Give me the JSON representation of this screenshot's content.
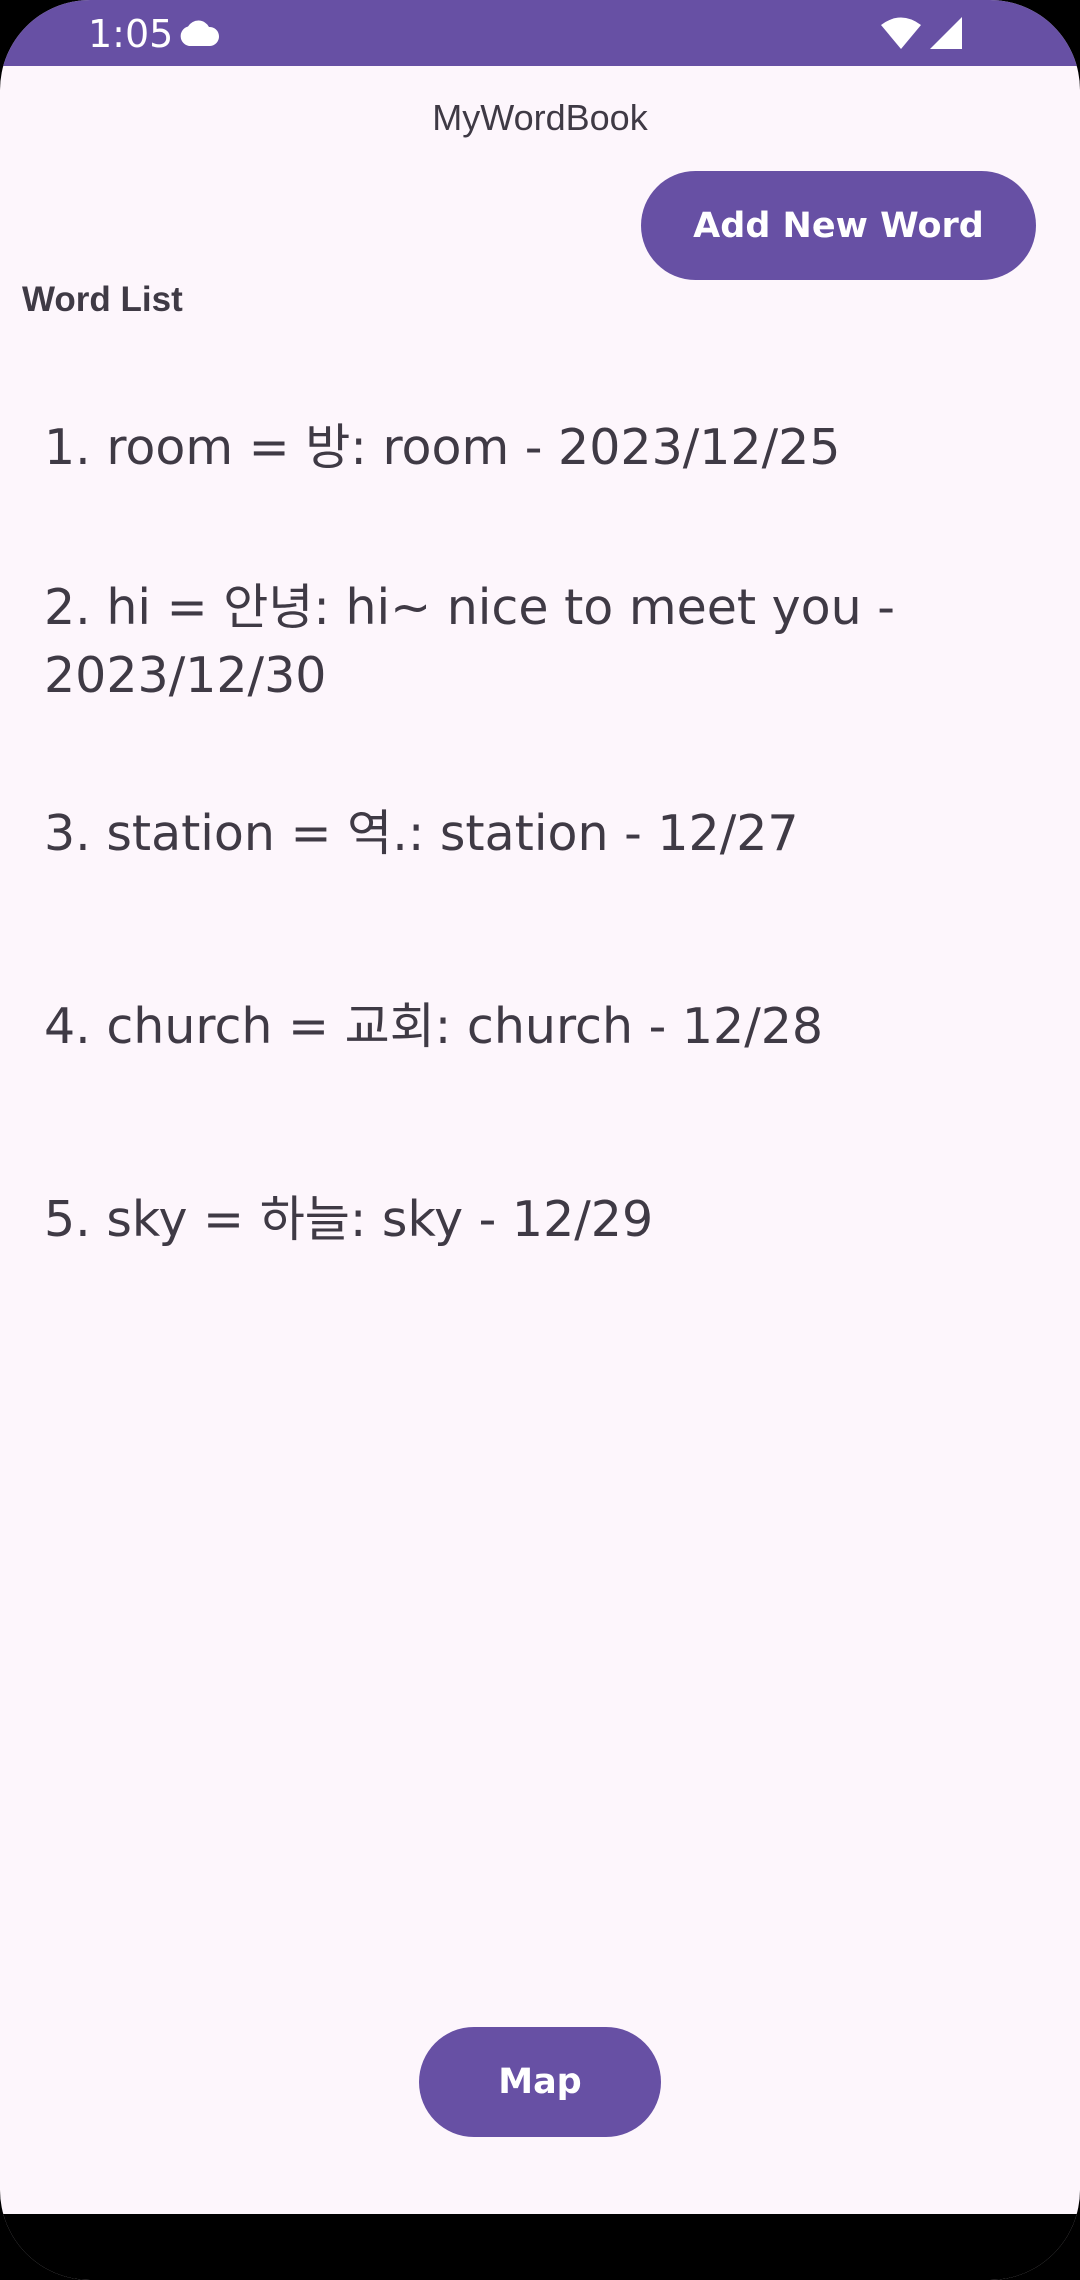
{
  "status_bar": {
    "time": "1:05",
    "icons": [
      "cloud-icon",
      "wifi-icon",
      "signal-icon"
    ],
    "background_color": "#6750a4"
  },
  "app": {
    "title": "MyWordBook",
    "background_color": "#fdf6fc"
  },
  "toolbar": {
    "add_word_label": "Add New Word"
  },
  "word_list": {
    "heading": "Word List",
    "items": [
      "1. room = 방: room - 2023/12/25",
      "2. hi = 안녕: hi~ nice to meet you - 2023/12/30",
      "3. station = 역.: station - 12/27",
      "4. church = 교회: church - 12/28",
      "5. sky = 하늘: sky - 12/29"
    ]
  },
  "footer": {
    "map_label": "Map"
  },
  "colors": {
    "accent": "#6750a4",
    "text": "#3f3a45",
    "button_text": "#ffffff"
  }
}
